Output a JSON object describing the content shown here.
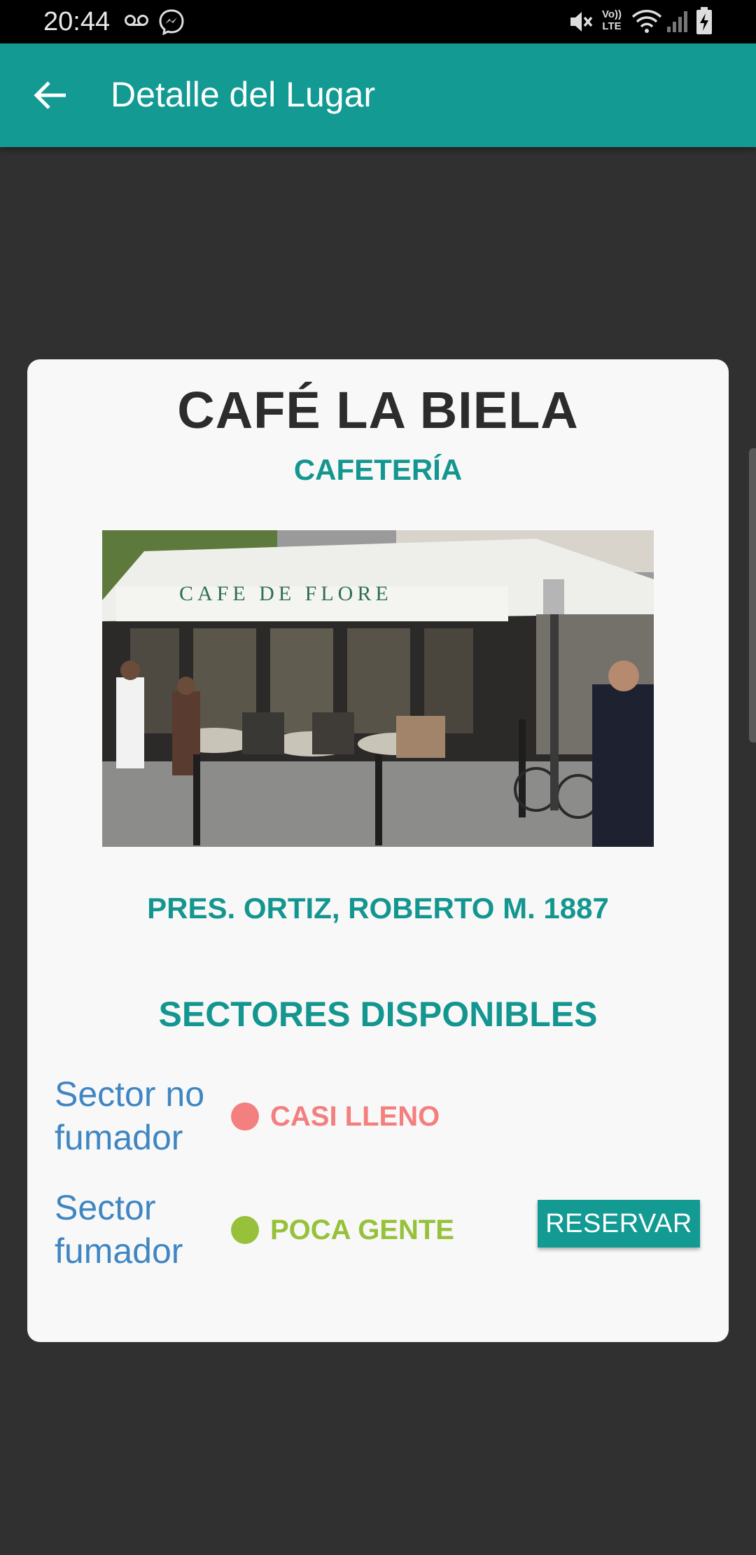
{
  "status_bar": {
    "time": "20:44",
    "icons": [
      "voicemail-icon",
      "messenger-icon",
      "mute-icon",
      "volte-icon",
      "wifi-icon",
      "signal-icon",
      "battery-charging-icon"
    ],
    "volte_text_top": "Vo))",
    "volte_text_bottom": "LTE"
  },
  "app_bar": {
    "title": "Detalle del Lugar",
    "back_icon": "arrow-back-icon"
  },
  "place": {
    "name": "CAFÉ LA BIELA",
    "category": "CAFETERÍA",
    "photo_sign": "CAFE DE FLORE",
    "address": "PRES. ORTIZ, ROBERTO M. 1887"
  },
  "sectors": {
    "title": "SECTORES DISPONIBLES",
    "items": [
      {
        "name": "Sector no fumador",
        "status": "CASI LLENO",
        "color": "#f47f7f",
        "action": ""
      },
      {
        "name": "Sector fumador",
        "status": "POCA GENTE",
        "color": "#97c13a",
        "action": "RESERVAR"
      }
    ]
  },
  "colors": {
    "primary": "#129a93",
    "background": "#303030",
    "card": "#f8f8f8",
    "sector_text": "#3f86c2"
  }
}
